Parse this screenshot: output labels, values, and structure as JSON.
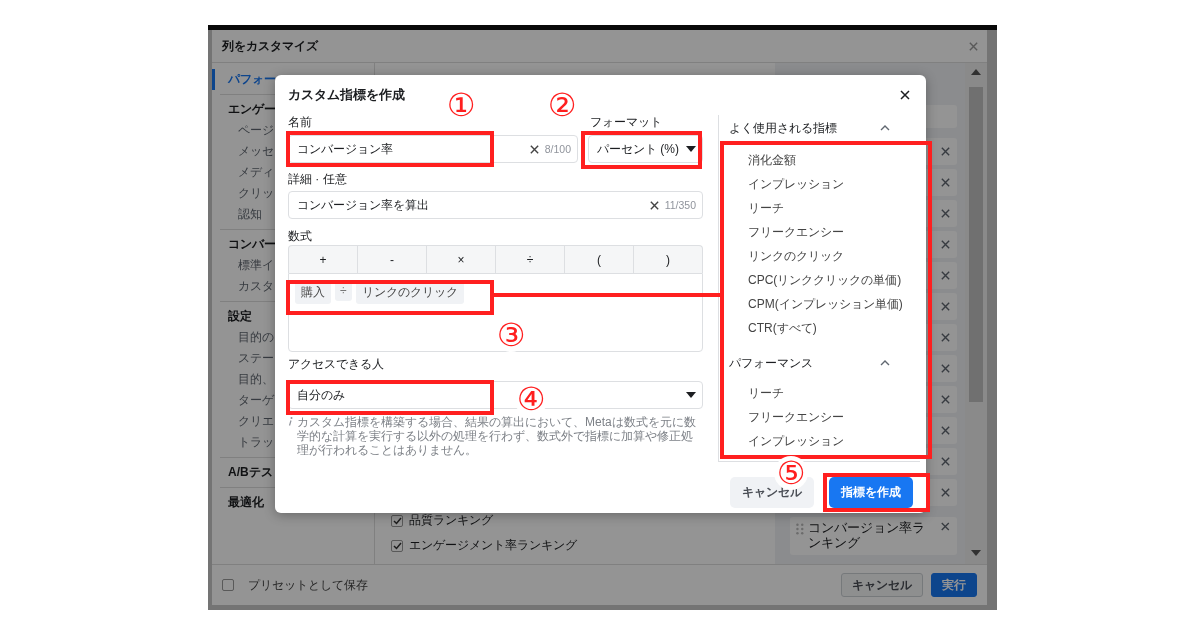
{
  "background_window": {
    "title": "列をカスタマイズ",
    "sidebar": [
      {
        "label": "パフォー",
        "selected": true
      },
      {
        "label": "エンゲー",
        "selected": false,
        "children": [
          {
            "label": "ページ",
            "selected": false
          },
          {
            "label": "メッセ",
            "selected": false
          },
          {
            "label": "メディ",
            "selected": false
          },
          {
            "label": "クリッ",
            "selected": false
          },
          {
            "label": "認知",
            "selected": false
          }
        ]
      },
      {
        "label": "コンバー",
        "selected": false,
        "children": [
          {
            "label": "標準イ",
            "selected": false
          },
          {
            "label": "カスタ",
            "selected": false
          }
        ]
      },
      {
        "label": "設定",
        "selected": false,
        "children": [
          {
            "label": "目的の",
            "selected": false
          },
          {
            "label": "ステー",
            "selected": false
          },
          {
            "label": "目的、",
            "selected": false
          },
          {
            "label": "ターゲ",
            "selected": false
          },
          {
            "label": "クリエ",
            "selected": false
          },
          {
            "label": "トラッ",
            "selected": false
          }
        ]
      },
      {
        "label": "A/Bテス",
        "selected": false
      },
      {
        "label": "最適化",
        "selected": false
      }
    ],
    "column_options": [
      {
        "label": "品質ランキング",
        "checked": true
      },
      {
        "label": "エンゲージメント率ランキング",
        "checked": true
      }
    ],
    "selected_columns": [
      {
        "label": "コンバージョン率ランキング"
      }
    ],
    "save_preset": {
      "label": "プリセットとして保存",
      "checked": false
    },
    "buttons": [
      {
        "label": "キャンセル",
        "kind": "secondary"
      },
      {
        "label": "実行",
        "kind": "primary"
      }
    ]
  },
  "dialog": {
    "title": "カスタム指標を作成",
    "name": {
      "label": "名前",
      "value": "コンバージョン率",
      "counter": "8/100"
    },
    "format": {
      "label": "フォーマット",
      "value": "パーセント (%)"
    },
    "description": {
      "label": "詳細 · 任意",
      "value": "コンバージョン率を算出",
      "counter": "11/350"
    },
    "formula": {
      "label": "数式",
      "operators": [
        "+",
        "-",
        "×",
        "÷",
        "(",
        ")"
      ],
      "tokens": [
        {
          "text": "購入",
          "kind": "metric"
        },
        {
          "text": "÷",
          "kind": "operator"
        },
        {
          "text": "リンクのクリック",
          "kind": "metric"
        }
      ]
    },
    "access": {
      "label": "アクセスできる人",
      "value": "自分のみ"
    },
    "notice": "カスタム指標を構築する場合、結果の算出において、Metaは数式を元に数学的な計算を実行する以外の処理を行わず、数式外で指標に加算や修正処理が行われることはありません。",
    "metric_groups": [
      {
        "title": "よく使用される指標",
        "expanded": true,
        "items": [
          "消化金額",
          "インプレッション",
          "リーチ",
          "フリークエンシー",
          "リンクのクリック",
          "CPC(リンククリックの単価)",
          "CPM(インプレッション単価)",
          "CTR(すべて)"
        ]
      },
      {
        "title": "パフォーマンス",
        "expanded": true,
        "items": [
          "リーチ",
          "フリークエンシー",
          "インプレッション"
        ]
      }
    ],
    "buttons": [
      {
        "label": "キャンセル",
        "kind": "secondary"
      },
      {
        "label": "指標を作成",
        "kind": "primary"
      }
    ]
  },
  "annotations": [
    "①",
    "②",
    "③",
    "④",
    "⑤"
  ]
}
